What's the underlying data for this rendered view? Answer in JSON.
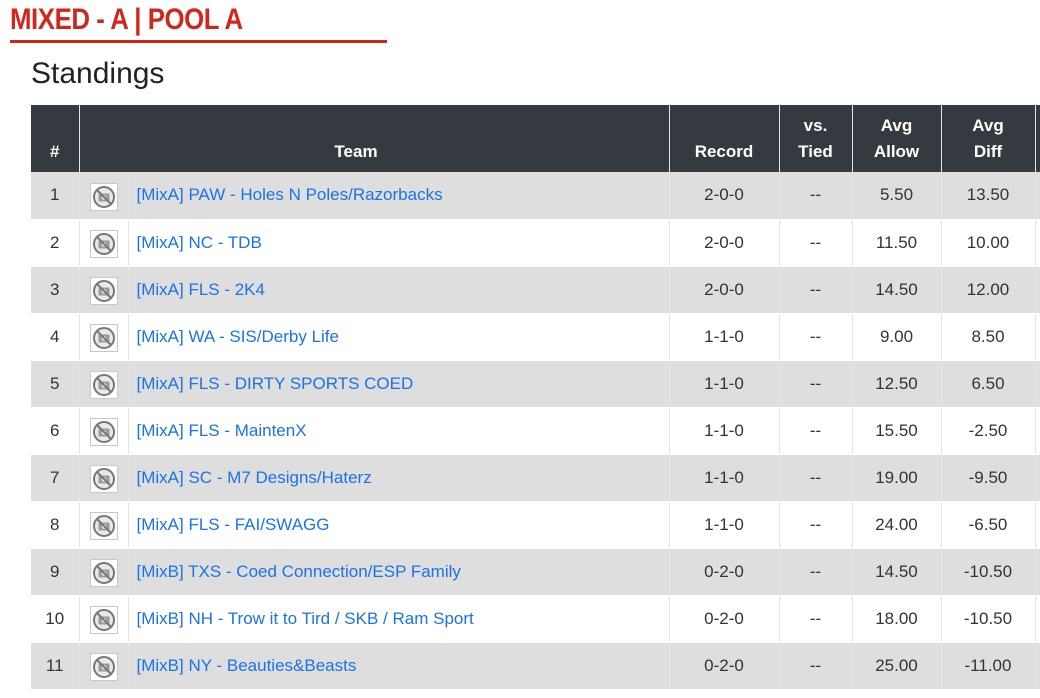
{
  "header": {
    "pool_title": "MIXED - A | POOL A",
    "section_title": "Standings"
  },
  "table": {
    "columns": {
      "rank": "#",
      "team": "Team",
      "record": "Record",
      "tied": "vs. Tied",
      "avg_allow": "Avg Allow",
      "avg_diff": "Avg Diff"
    },
    "rows": [
      {
        "rank": "1",
        "team": "[MixA] PAW - Holes N Poles/Razorbacks",
        "record": "2-0-0",
        "tied": "--",
        "avg_allow": "5.50",
        "avg_diff": "13.50"
      },
      {
        "rank": "2",
        "team": "[MixA] NC - TDB",
        "record": "2-0-0",
        "tied": "--",
        "avg_allow": "11.50",
        "avg_diff": "10.00"
      },
      {
        "rank": "3",
        "team": "[MixA] FLS - 2K4",
        "record": "2-0-0",
        "tied": "--",
        "avg_allow": "14.50",
        "avg_diff": "12.00"
      },
      {
        "rank": "4",
        "team": "[MixA] WA - SIS/Derby Life",
        "record": "1-1-0",
        "tied": "--",
        "avg_allow": "9.00",
        "avg_diff": "8.50"
      },
      {
        "rank": "5",
        "team": "[MixA] FLS - DIRTY SPORTS COED",
        "record": "1-1-0",
        "tied": "--",
        "avg_allow": "12.50",
        "avg_diff": "6.50"
      },
      {
        "rank": "6",
        "team": "[MixA] FLS - MaintenX",
        "record": "1-1-0",
        "tied": "--",
        "avg_allow": "15.50",
        "avg_diff": "-2.50"
      },
      {
        "rank": "7",
        "team": "[MixA] SC - M7 Designs/Haterz",
        "record": "1-1-0",
        "tied": "--",
        "avg_allow": "19.00",
        "avg_diff": "-9.50"
      },
      {
        "rank": "8",
        "team": "[MixA] FLS - FAI/SWAGG",
        "record": "1-1-0",
        "tied": "--",
        "avg_allow": "24.00",
        "avg_diff": "-6.50"
      },
      {
        "rank": "9",
        "team": "[MixB] TXS - Coed Connection/ESP Family",
        "record": "0-2-0",
        "tied": "--",
        "avg_allow": "14.50",
        "avg_diff": "-10.50"
      },
      {
        "rank": "10",
        "team": "[MixB] NH - Trow it to Tird / SKB / Ram Sport",
        "record": "0-2-0",
        "tied": "--",
        "avg_allow": "18.00",
        "avg_diff": "-10.50"
      },
      {
        "rank": "11",
        "team": "[MixB] NY - Beauties&Beasts",
        "record": "0-2-0",
        "tied": "--",
        "avg_allow": "25.00",
        "avg_diff": "-11.00"
      }
    ]
  },
  "icons": {
    "team_logo_placeholder": "no-image-icon"
  },
  "colors": {
    "title_red": "#d0271d",
    "header_bg": "#343a40",
    "row_shade": "#dedede",
    "link_blue": "#1a73e8"
  }
}
